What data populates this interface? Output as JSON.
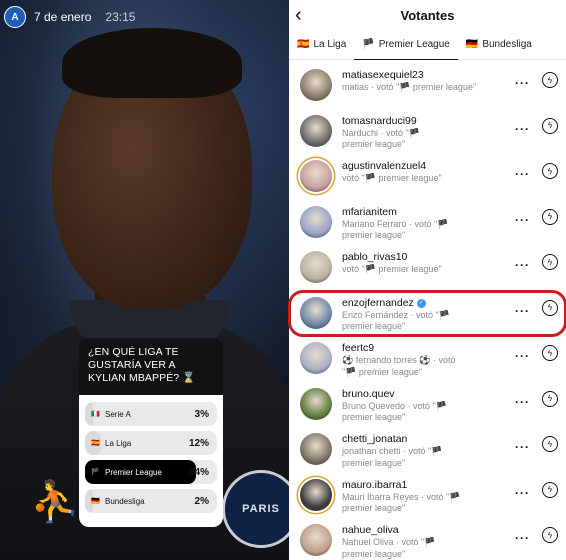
{
  "story": {
    "date": "7 de enero",
    "time": "23:15",
    "poll": {
      "question": "¿EN QUÉ LIGA TE GUSTARÍA VER A KYLIAN MBAPPÉ? ⌛",
      "options": [
        {
          "flag": "🇮🇹",
          "label": "Serie A",
          "percent": "3",
          "value": 3,
          "selected": false
        },
        {
          "flag": "🇪🇸",
          "label": "La Liga",
          "percent": "12",
          "value": 12,
          "selected": false
        },
        {
          "flag": "🏴",
          "label": "Premier League",
          "percent": "84",
          "value": 84,
          "selected": true
        },
        {
          "flag": "🇩🇪",
          "label": "Bundesliga",
          "percent": "2",
          "value": 2,
          "selected": false
        }
      ],
      "percent_sign": "%"
    },
    "crest_text": "PARIS"
  },
  "panel": {
    "title": "Votantes",
    "tabs": [
      {
        "flag": "🇪🇸",
        "label": "La Liga"
      },
      {
        "flag": "🏴",
        "label": "Premier League"
      },
      {
        "flag": "🇩🇪",
        "label": "Bundesliga"
      }
    ],
    "active_tab": "Premier League",
    "voters": [
      {
        "username": "matiasexequiel23",
        "line1": "matias · votó \"🏴 premier league\"",
        "line2": "",
        "verified": false
      },
      {
        "username": "tomasnarduci99",
        "line1": "Narduchi · votó \"🏴",
        "line2": "premier league\"",
        "verified": false
      },
      {
        "username": "agustinvalenzuel4",
        "line1": "votó \"🏴 premier league\"",
        "line2": "",
        "verified": false
      },
      {
        "username": "mfarianitem",
        "line1": "Mariano Ferraro · votó \"🏴",
        "line2": "premier league\"",
        "verified": false
      },
      {
        "username": "pablo_rivas10",
        "line1": "votó \"🏴 premier league\"",
        "line2": "",
        "verified": false
      },
      {
        "username": "enzojfernandez",
        "line1": "Enzo Fernández · votó \"🏴",
        "line2": "premier league\"",
        "verified": true
      },
      {
        "username": "feertc9",
        "line1": "⚽ fernando torres ⚽ · votó",
        "line2": "\"🏴 premier league\"",
        "verified": false
      },
      {
        "username": "bruno.quev",
        "line1": "Bruno Quevedo · votó \"🏴",
        "line2": "premier league\"",
        "verified": false
      },
      {
        "username": "chetti_jonatan",
        "line1": "jonathan chetti · votó \"🏴",
        "line2": "premier league\"",
        "verified": false
      },
      {
        "username": "mauro.ibarra1",
        "line1": "Mauri Ibarra Reyes · votó \"🏴",
        "line2": "premier league\"",
        "verified": false
      },
      {
        "username": "nahue_oliva",
        "line1": "Nahuel Oliva · votó \"🏴",
        "line2": "premier league\"",
        "verified": false
      }
    ]
  }
}
